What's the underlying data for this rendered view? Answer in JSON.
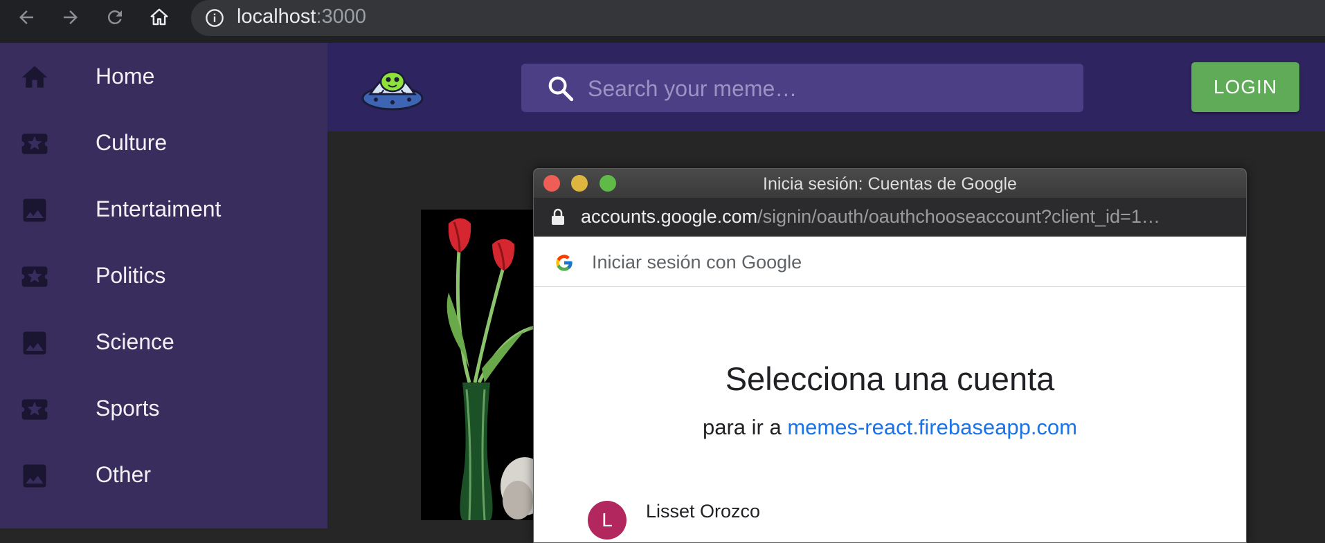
{
  "browser": {
    "url_host": "localhost",
    "url_port": ":3000",
    "icons": [
      "arrow-back-icon",
      "arrow-forward-icon",
      "reload-icon",
      "home-icon",
      "info-icon"
    ]
  },
  "sidebar": {
    "items": [
      {
        "label": "Home",
        "icon": "home-icon"
      },
      {
        "label": "Culture",
        "icon": "ticket-icon"
      },
      {
        "label": "Entertaiment",
        "icon": "image-icon"
      },
      {
        "label": "Politics",
        "icon": "ticket-icon"
      },
      {
        "label": "Science",
        "icon": "image-icon"
      },
      {
        "label": "Sports",
        "icon": "ticket-icon"
      },
      {
        "label": "Other",
        "icon": "image-icon"
      }
    ]
  },
  "header": {
    "search_placeholder": "Search your meme…",
    "login_label": "LOGIN"
  },
  "popup": {
    "window_title": "Inicia sesión: Cuentas de Google",
    "url_domain": "accounts.google.com",
    "url_path": "/signin/oauth/oauthchooseaccount?client_id=1…",
    "google_bar_label": "Iniciar sesión con Google",
    "heading": "Selecciona una cuenta",
    "subheading_prefix": "para ir a ",
    "subheading_link": "memes-react.firebaseapp.com",
    "account": {
      "initial": "L",
      "name": "Lisset Orozco"
    }
  },
  "colors": {
    "sidebar_bg": "#382d5c",
    "appbar_bg": "#2e2460",
    "search_bg": "#4c3f86",
    "login_bg": "#5fab58",
    "link": "#1a73e8",
    "avatar_bg": "#b2285e"
  }
}
